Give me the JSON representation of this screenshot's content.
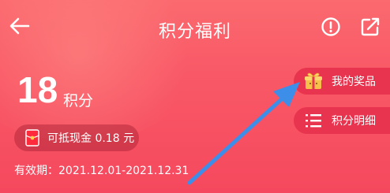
{
  "header": {
    "title": "积分福利",
    "back_icon": "arrow-left-icon",
    "info_icon": "exclamation-circle-icon",
    "edit_icon": "external-edit-icon"
  },
  "points": {
    "value": "18",
    "unit": "积分"
  },
  "cash": {
    "text": "可抵现金 0.18 元",
    "icon": "red-packet-icon"
  },
  "validity": {
    "text": "有效期：2021.12.01-2021.12.31"
  },
  "side_buttons": {
    "prizes_label": "我的奖品",
    "prizes_icon": "gift-box-icon",
    "details_label": "积分明细",
    "details_icon": "list-icon"
  },
  "colors": {
    "background_top": "#fb6a6f",
    "background_bottom": "#f5485e",
    "side_button": "#e8344e",
    "annotation_arrow": "#3d8ee8"
  }
}
